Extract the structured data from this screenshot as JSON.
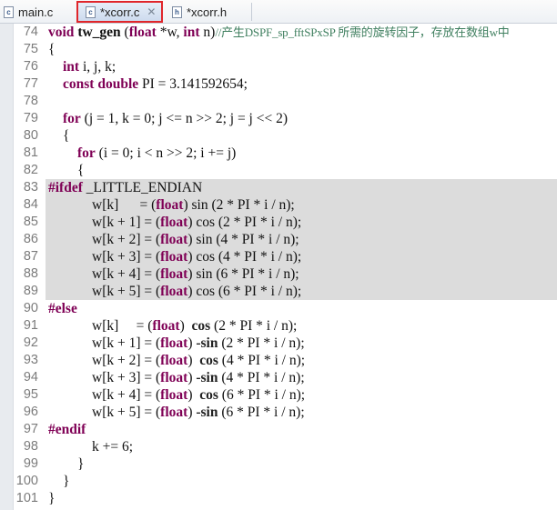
{
  "tabs": [
    {
      "label": "main.c",
      "icon": "c-file-icon",
      "glyph": "c",
      "active": false
    },
    {
      "label": "*xcorr.c",
      "icon": "c-file-icon",
      "glyph": "c",
      "active": true,
      "close": "✕"
    },
    {
      "label": "*xcorr.h",
      "icon": "h-file-icon",
      "glyph": "h",
      "active": false
    }
  ],
  "colors": {
    "keyword": "#7f0055",
    "comment": "#3f7f5f",
    "highlight": "#dcdcdc",
    "active_tab_border": "#e0262b"
  },
  "highlighted_lines": [
    83,
    84,
    85,
    86,
    87,
    88,
    89
  ],
  "lines": [
    {
      "n": "74",
      "t": [
        [
          "kw",
          "void"
        ],
        [
          "plain",
          " "
        ],
        [
          "bold",
          "tw_gen"
        ],
        [
          "plain",
          " ("
        ],
        [
          "kw",
          "float"
        ],
        [
          "plain",
          " *w, "
        ],
        [
          "kw",
          "int"
        ],
        [
          "plain",
          " n)"
        ],
        [
          "cm",
          "//产生DSPF_sp_fftSPxSP 所需的旋转因子，存放在数组w中"
        ]
      ]
    },
    {
      "n": "75",
      "t": [
        [
          "plain",
          "{"
        ]
      ]
    },
    {
      "n": "76",
      "t": [
        [
          "plain",
          "\t"
        ],
        [
          "kw",
          "int"
        ],
        [
          "plain",
          " i, j, k;"
        ]
      ]
    },
    {
      "n": "77",
      "t": [
        [
          "plain",
          "\t"
        ],
        [
          "kw",
          "const"
        ],
        [
          "plain",
          " "
        ],
        [
          "kw",
          "double"
        ],
        [
          "plain",
          " PI = 3.141592654;"
        ]
      ]
    },
    {
      "n": "78",
      "t": []
    },
    {
      "n": "79",
      "t": [
        [
          "plain",
          "\t"
        ],
        [
          "kw",
          "for"
        ],
        [
          "plain",
          " (j = 1, k = 0; j <= n >> 2; j = j << 2)"
        ]
      ]
    },
    {
      "n": "80",
      "t": [
        [
          "plain",
          "\t{"
        ]
      ]
    },
    {
      "n": "81",
      "t": [
        [
          "plain",
          "\t\t"
        ],
        [
          "kw",
          "for"
        ],
        [
          "plain",
          " (i = 0; i < n >> 2; i += j)"
        ]
      ]
    },
    {
      "n": "82",
      "t": [
        [
          "plain",
          "\t\t{"
        ]
      ]
    },
    {
      "n": "83",
      "t": [
        [
          "kw",
          "#ifdef"
        ],
        [
          "plain",
          " _LITTLE_ENDIAN"
        ]
      ]
    },
    {
      "n": "84",
      "t": [
        [
          "plain",
          "\t\t\tw[k]      = ("
        ],
        [
          "kw",
          "float"
        ],
        [
          "plain",
          ") sin (2 * PI * i / n);"
        ]
      ]
    },
    {
      "n": "85",
      "t": [
        [
          "plain",
          "\t\t\tw[k + 1] = ("
        ],
        [
          "kw",
          "float"
        ],
        [
          "plain",
          ") cos (2 * PI * i / n);"
        ]
      ]
    },
    {
      "n": "86",
      "t": [
        [
          "plain",
          "\t\t\tw[k + 2] = ("
        ],
        [
          "kw",
          "float"
        ],
        [
          "plain",
          ") sin (4 * PI * i / n);"
        ]
      ]
    },
    {
      "n": "87",
      "t": [
        [
          "plain",
          "\t\t\tw[k + 3] = ("
        ],
        [
          "kw",
          "float"
        ],
        [
          "plain",
          ") cos (4 * PI * i / n);"
        ]
      ]
    },
    {
      "n": "88",
      "t": [
        [
          "plain",
          "\t\t\tw[k + 4] = ("
        ],
        [
          "kw",
          "float"
        ],
        [
          "plain",
          ") sin (6 * PI * i / n);"
        ]
      ]
    },
    {
      "n": "89",
      "t": [
        [
          "plain",
          "\t\t\tw[k + 5] = ("
        ],
        [
          "kw",
          "float"
        ],
        [
          "plain",
          ") cos (6 * PI * i / n);"
        ]
      ]
    },
    {
      "n": "90",
      "t": [
        [
          "kw",
          "#else"
        ]
      ]
    },
    {
      "n": "91",
      "t": [
        [
          "plain",
          "\t\t\tw[k]     = ("
        ],
        [
          "kw",
          "float"
        ],
        [
          "plain",
          ")  "
        ],
        [
          "fn",
          "cos"
        ],
        [
          "plain",
          " (2 * PI * i / n);"
        ]
      ]
    },
    {
      "n": "92",
      "t": [
        [
          "plain",
          "\t\t\tw[k + 1] = ("
        ],
        [
          "kw",
          "float"
        ],
        [
          "plain",
          ") "
        ],
        [
          "fn",
          "-sin"
        ],
        [
          "plain",
          " (2 * PI * i / n);"
        ]
      ]
    },
    {
      "n": "93",
      "t": [
        [
          "plain",
          "\t\t\tw[k + 2] = ("
        ],
        [
          "kw",
          "float"
        ],
        [
          "plain",
          ")  "
        ],
        [
          "fn",
          "cos"
        ],
        [
          "plain",
          " (4 * PI * i / n);"
        ]
      ]
    },
    {
      "n": "94",
      "t": [
        [
          "plain",
          "\t\t\tw[k + 3] = ("
        ],
        [
          "kw",
          "float"
        ],
        [
          "plain",
          ") "
        ],
        [
          "fn",
          "-sin"
        ],
        [
          "plain",
          " (4 * PI * i / n);"
        ]
      ]
    },
    {
      "n": "95",
      "t": [
        [
          "plain",
          "\t\t\tw[k + 4] = ("
        ],
        [
          "kw",
          "float"
        ],
        [
          "plain",
          ")  "
        ],
        [
          "fn",
          "cos"
        ],
        [
          "plain",
          " (6 * PI * i / n);"
        ]
      ]
    },
    {
      "n": "96",
      "t": [
        [
          "plain",
          "\t\t\tw[k + 5] = ("
        ],
        [
          "kw",
          "float"
        ],
        [
          "plain",
          ") "
        ],
        [
          "fn",
          "-sin"
        ],
        [
          "plain",
          " (6 * PI * i / n);"
        ]
      ]
    },
    {
      "n": "97",
      "t": [
        [
          "kw",
          "#endif"
        ]
      ]
    },
    {
      "n": "98",
      "t": [
        [
          "plain",
          "\t\t\tk += 6;"
        ]
      ]
    },
    {
      "n": "99",
      "t": [
        [
          "plain",
          "\t\t}"
        ]
      ]
    },
    {
      "n": "100",
      "t": [
        [
          "plain",
          "\t}"
        ]
      ]
    },
    {
      "n": "101",
      "t": [
        [
          "plain",
          "}"
        ]
      ]
    }
  ]
}
